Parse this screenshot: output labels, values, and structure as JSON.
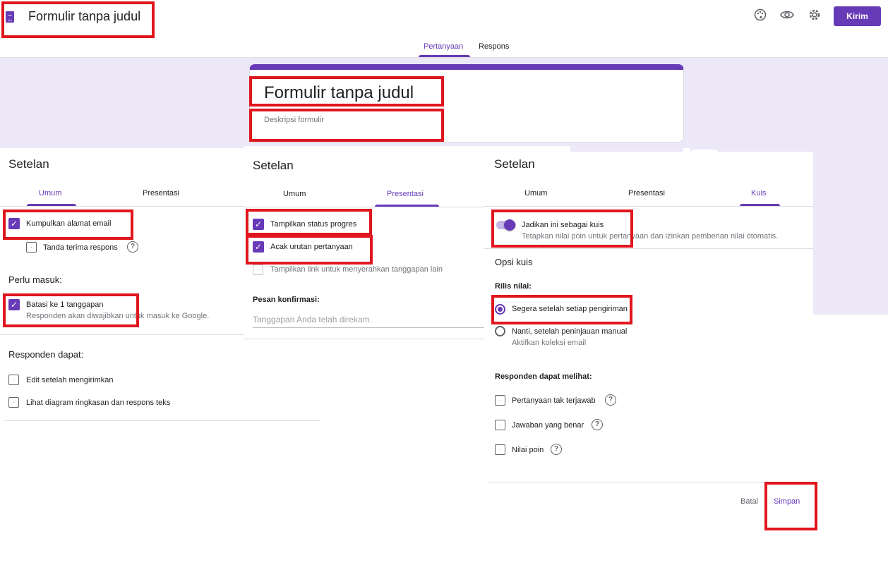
{
  "header": {
    "title": "Formulir tanpa judul",
    "send_label": "Kirim",
    "icons": [
      "palette-icon",
      "eye-icon",
      "gear-icon"
    ]
  },
  "top_tabs": [
    {
      "label": "Pertanyaan",
      "active": true
    },
    {
      "label": "Respons",
      "active": false
    }
  ],
  "form": {
    "title": "Formulir tanpa judul",
    "description_placeholder": "Deskripsi formulir"
  },
  "panel_umum": {
    "title": "Setelan",
    "tabs": [
      "Umum",
      "Presentasi"
    ],
    "collect_email": "Kumpulkan alamat email",
    "receipt": "Tanda terima respons",
    "login_section": "Perlu masuk:",
    "limit_one": "Batasi ke 1 tanggapan",
    "limit_one_sub": "Responden akan diwajibkan untuk masuk ke Google.",
    "respondents_section": "Responden dapat:",
    "edit_after": "Edit setelah mengirimkan",
    "see_summary": "Lihat diagram ringkasan dan respons teks"
  },
  "panel_presentasi": {
    "title": "Setelan",
    "tabs": [
      "Umum",
      "Presentasi"
    ],
    "show_progress": "Tampilkan status progres",
    "shuffle": "Acak urutan pertanyaan",
    "show_link": "Tampilkan link untuk menyerahkan tanggapan lain",
    "confirm_label": "Pesan konfirmasi:",
    "confirm_placeholder": "Tanggapan Anda telah direkam."
  },
  "panel_kuis": {
    "title": "Setelan",
    "tabs": [
      "Umum",
      "Presentasi",
      "Kuis"
    ],
    "make_quiz": "Jadikan ini sebagai kuis",
    "make_quiz_sub": "Tetapkan nilai poin untuk pertanyaan dan izinkan pemberian nilai otomatis.",
    "options_title": "Opsi kuis",
    "release_label": "Rilis nilai:",
    "release_immediate": "Segera setelah setiap pengiriman",
    "release_later": "Nanti, setelah peninjauan manual",
    "release_later_sub": "Aktifkan koleksi email",
    "can_see_label": "Responden dapat melihat:",
    "missed": "Pertanyaan tak terjawab",
    "correct": "Jawaban yang benar",
    "points": "Nilai poin",
    "cancel": "Batal",
    "save": "Simpan"
  },
  "colors": {
    "accent": "#673ab7",
    "highlight_box": "#e0161e",
    "background": "#ece8f7"
  }
}
